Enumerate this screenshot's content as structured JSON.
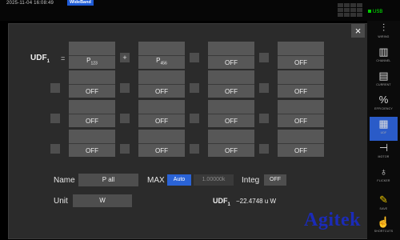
{
  "status": {
    "datetime": "2025-11-04  16:08:49",
    "mode_badge": "WideBand",
    "usb_label": "USB",
    "accent_color": "#1e5bd6"
  },
  "dialog": {
    "close_label": "×",
    "udf_label": "UDF",
    "udf_sub": "1",
    "equals": "=",
    "operator_1": "+",
    "terms": [
      {
        "main": "P",
        "sub": "123"
      },
      {
        "main": "P",
        "sub": "456"
      },
      {
        "main": "OFF"
      },
      {
        "main": "OFF"
      }
    ],
    "rows": [
      [
        "OFF",
        "OFF",
        "OFF",
        "OFF"
      ],
      [
        "OFF",
        "OFF",
        "OFF",
        "OFF"
      ],
      [
        "OFF",
        "OFF",
        "OFF",
        "OFF"
      ]
    ],
    "name_label": "Name",
    "name_value": "P all",
    "max_label": "MAX",
    "max_mode": "Auto",
    "max_scale": "1.00000k",
    "integ_label": "Integ",
    "integ_value": "OFF",
    "unit_label": "Unit",
    "unit_value": "W",
    "result_label": "UDF",
    "result_sub": "1",
    "result_value": "−22.4748 u W"
  },
  "sidebar": [
    {
      "icon": "wiring-icon",
      "glyph": "⫶",
      "caption": "WIRING"
    },
    {
      "icon": "channel-icon",
      "glyph": "▥",
      "caption": "CHANNEL"
    },
    {
      "icon": "current-icon",
      "glyph": "▤",
      "caption": "CURRENT"
    },
    {
      "icon": "efficiency-icon",
      "glyph": "%",
      "caption": "EFFICIENCY"
    },
    {
      "icon": "udf-icon",
      "glyph": "▦",
      "caption": "UDF"
    },
    {
      "icon": "motor-icon",
      "glyph": "⊣",
      "caption": "MOTOR"
    },
    {
      "icon": "flicker-icon",
      "glyph": "♁",
      "caption": "FLICKER"
    },
    {
      "icon": "save-icon",
      "glyph": "✎",
      "caption": "SAVE"
    },
    {
      "icon": "shortcuts-icon",
      "glyph": "☝",
      "caption": "SHORTCUTS"
    }
  ],
  "watermark": "Agitek"
}
